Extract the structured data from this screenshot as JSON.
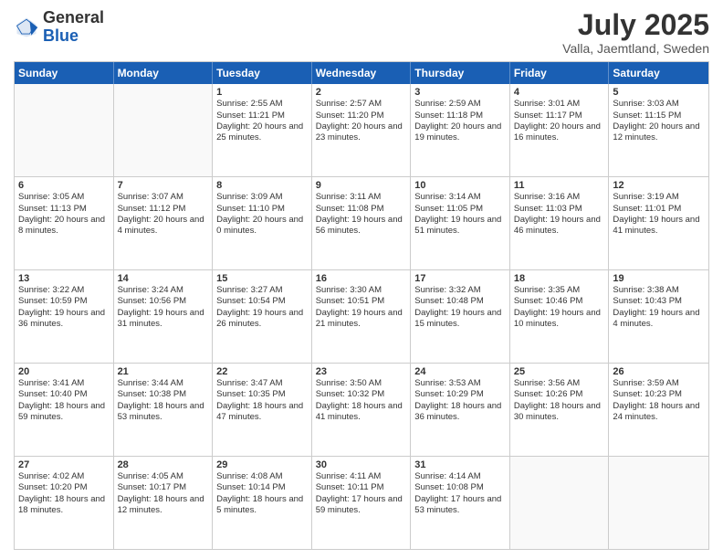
{
  "logo": {
    "line1": "General",
    "line2": "Blue"
  },
  "header": {
    "month": "July 2025",
    "location": "Valla, Jaemtland, Sweden"
  },
  "weekdays": [
    "Sunday",
    "Monday",
    "Tuesday",
    "Wednesday",
    "Thursday",
    "Friday",
    "Saturday"
  ],
  "rows": [
    [
      {
        "day": "",
        "empty": true
      },
      {
        "day": "",
        "empty": true
      },
      {
        "day": "1",
        "sunrise": "Sunrise: 2:55 AM",
        "sunset": "Sunset: 11:21 PM",
        "daylight": "Daylight: 20 hours and 25 minutes."
      },
      {
        "day": "2",
        "sunrise": "Sunrise: 2:57 AM",
        "sunset": "Sunset: 11:20 PM",
        "daylight": "Daylight: 20 hours and 23 minutes."
      },
      {
        "day": "3",
        "sunrise": "Sunrise: 2:59 AM",
        "sunset": "Sunset: 11:18 PM",
        "daylight": "Daylight: 20 hours and 19 minutes."
      },
      {
        "day": "4",
        "sunrise": "Sunrise: 3:01 AM",
        "sunset": "Sunset: 11:17 PM",
        "daylight": "Daylight: 20 hours and 16 minutes."
      },
      {
        "day": "5",
        "sunrise": "Sunrise: 3:03 AM",
        "sunset": "Sunset: 11:15 PM",
        "daylight": "Daylight: 20 hours and 12 minutes."
      }
    ],
    [
      {
        "day": "6",
        "sunrise": "Sunrise: 3:05 AM",
        "sunset": "Sunset: 11:13 PM",
        "daylight": "Daylight: 20 hours and 8 minutes."
      },
      {
        "day": "7",
        "sunrise": "Sunrise: 3:07 AM",
        "sunset": "Sunset: 11:12 PM",
        "daylight": "Daylight: 20 hours and 4 minutes."
      },
      {
        "day": "8",
        "sunrise": "Sunrise: 3:09 AM",
        "sunset": "Sunset: 11:10 PM",
        "daylight": "Daylight: 20 hours and 0 minutes."
      },
      {
        "day": "9",
        "sunrise": "Sunrise: 3:11 AM",
        "sunset": "Sunset: 11:08 PM",
        "daylight": "Daylight: 19 hours and 56 minutes."
      },
      {
        "day": "10",
        "sunrise": "Sunrise: 3:14 AM",
        "sunset": "Sunset: 11:05 PM",
        "daylight": "Daylight: 19 hours and 51 minutes."
      },
      {
        "day": "11",
        "sunrise": "Sunrise: 3:16 AM",
        "sunset": "Sunset: 11:03 PM",
        "daylight": "Daylight: 19 hours and 46 minutes."
      },
      {
        "day": "12",
        "sunrise": "Sunrise: 3:19 AM",
        "sunset": "Sunset: 11:01 PM",
        "daylight": "Daylight: 19 hours and 41 minutes."
      }
    ],
    [
      {
        "day": "13",
        "sunrise": "Sunrise: 3:22 AM",
        "sunset": "Sunset: 10:59 PM",
        "daylight": "Daylight: 19 hours and 36 minutes."
      },
      {
        "day": "14",
        "sunrise": "Sunrise: 3:24 AM",
        "sunset": "Sunset: 10:56 PM",
        "daylight": "Daylight: 19 hours and 31 minutes."
      },
      {
        "day": "15",
        "sunrise": "Sunrise: 3:27 AM",
        "sunset": "Sunset: 10:54 PM",
        "daylight": "Daylight: 19 hours and 26 minutes."
      },
      {
        "day": "16",
        "sunrise": "Sunrise: 3:30 AM",
        "sunset": "Sunset: 10:51 PM",
        "daylight": "Daylight: 19 hours and 21 minutes."
      },
      {
        "day": "17",
        "sunrise": "Sunrise: 3:32 AM",
        "sunset": "Sunset: 10:48 PM",
        "daylight": "Daylight: 19 hours and 15 minutes."
      },
      {
        "day": "18",
        "sunrise": "Sunrise: 3:35 AM",
        "sunset": "Sunset: 10:46 PM",
        "daylight": "Daylight: 19 hours and 10 minutes."
      },
      {
        "day": "19",
        "sunrise": "Sunrise: 3:38 AM",
        "sunset": "Sunset: 10:43 PM",
        "daylight": "Daylight: 19 hours and 4 minutes."
      }
    ],
    [
      {
        "day": "20",
        "sunrise": "Sunrise: 3:41 AM",
        "sunset": "Sunset: 10:40 PM",
        "daylight": "Daylight: 18 hours and 59 minutes."
      },
      {
        "day": "21",
        "sunrise": "Sunrise: 3:44 AM",
        "sunset": "Sunset: 10:38 PM",
        "daylight": "Daylight: 18 hours and 53 minutes."
      },
      {
        "day": "22",
        "sunrise": "Sunrise: 3:47 AM",
        "sunset": "Sunset: 10:35 PM",
        "daylight": "Daylight: 18 hours and 47 minutes."
      },
      {
        "day": "23",
        "sunrise": "Sunrise: 3:50 AM",
        "sunset": "Sunset: 10:32 PM",
        "daylight": "Daylight: 18 hours and 41 minutes."
      },
      {
        "day": "24",
        "sunrise": "Sunrise: 3:53 AM",
        "sunset": "Sunset: 10:29 PM",
        "daylight": "Daylight: 18 hours and 36 minutes."
      },
      {
        "day": "25",
        "sunrise": "Sunrise: 3:56 AM",
        "sunset": "Sunset: 10:26 PM",
        "daylight": "Daylight: 18 hours and 30 minutes."
      },
      {
        "day": "26",
        "sunrise": "Sunrise: 3:59 AM",
        "sunset": "Sunset: 10:23 PM",
        "daylight": "Daylight: 18 hours and 24 minutes."
      }
    ],
    [
      {
        "day": "27",
        "sunrise": "Sunrise: 4:02 AM",
        "sunset": "Sunset: 10:20 PM",
        "daylight": "Daylight: 18 hours and 18 minutes."
      },
      {
        "day": "28",
        "sunrise": "Sunrise: 4:05 AM",
        "sunset": "Sunset: 10:17 PM",
        "daylight": "Daylight: 18 hours and 12 minutes."
      },
      {
        "day": "29",
        "sunrise": "Sunrise: 4:08 AM",
        "sunset": "Sunset: 10:14 PM",
        "daylight": "Daylight: 18 hours and 5 minutes."
      },
      {
        "day": "30",
        "sunrise": "Sunrise: 4:11 AM",
        "sunset": "Sunset: 10:11 PM",
        "daylight": "Daylight: 17 hours and 59 minutes."
      },
      {
        "day": "31",
        "sunrise": "Sunrise: 4:14 AM",
        "sunset": "Sunset: 10:08 PM",
        "daylight": "Daylight: 17 hours and 53 minutes."
      },
      {
        "day": "",
        "empty": true
      },
      {
        "day": "",
        "empty": true
      }
    ]
  ]
}
